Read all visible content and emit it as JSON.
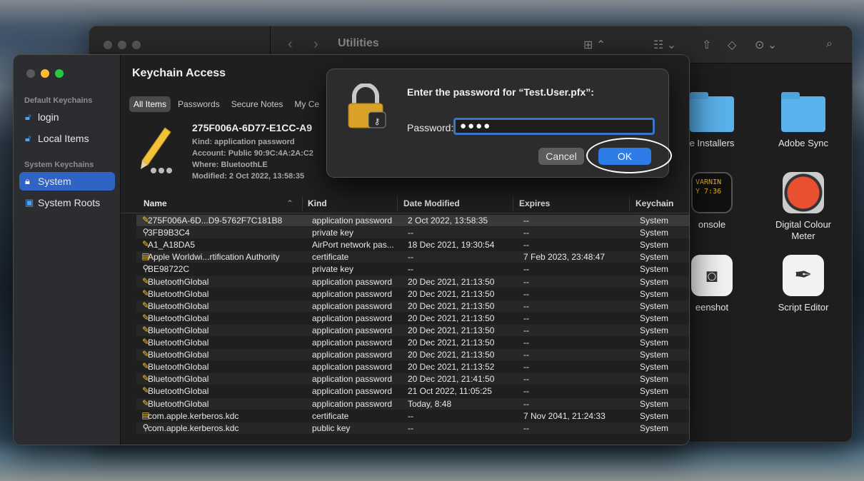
{
  "finder": {
    "title": "Utilities",
    "apps": [
      {
        "label": "e Installers",
        "icon": "folder-icon"
      },
      {
        "label": "Adobe Sync",
        "icon": "folder-icon"
      },
      {
        "label": "onsole",
        "icon": "console-icon",
        "icon_text": "VARNIN\nY 7:36"
      },
      {
        "label": "Digital Colour\nMeter",
        "icon": "colour-meter-icon"
      },
      {
        "label": "eenshot",
        "icon": "screenshot-icon"
      },
      {
        "label": "Script Editor",
        "icon": "script-editor-icon"
      }
    ]
  },
  "keychain": {
    "title": "Keychain Access",
    "sidebar": {
      "default_header": "Default Keychains",
      "system_header": "System Keychains",
      "items": [
        {
          "label": "login",
          "icon": "lock-open-icon"
        },
        {
          "label": "Local Items",
          "icon": "lock-open-icon"
        },
        {
          "label": "System",
          "icon": "lock-icon"
        },
        {
          "label": "System Roots",
          "icon": "cabinet-icon"
        }
      ]
    },
    "tabs": [
      "All Items",
      "Passwords",
      "Secure Notes",
      "My Ce"
    ],
    "detail": {
      "name": "275F006A-6D77-E1CC-A9",
      "kind": "Kind: application password",
      "account": "Account: Public 90:9C:4A:2A:C2",
      "where": "Where: BluetoothLE",
      "modified": "Modified: 2 Oct 2022, 13:58:35"
    },
    "columns": [
      "Name",
      "Kind",
      "Date Modified",
      "Expires",
      "Keychain"
    ],
    "rows": [
      {
        "icon": "pencil-icon",
        "name": "275F006A-6D...D9-5762F7C181B8",
        "kind": "application password",
        "date": "2 Oct 2022, 13:58:35",
        "expires": "--",
        "keychain": "System"
      },
      {
        "icon": "key-icon",
        "name": "3FB9B3C4",
        "kind": "private key",
        "date": "--",
        "expires": "--",
        "keychain": "System"
      },
      {
        "icon": "pencil-icon",
        "name": "A1_A18DA5",
        "kind": "AirPort network pas...",
        "date": "18 Dec 2021, 19:30:54",
        "expires": "--",
        "keychain": "System"
      },
      {
        "icon": "certificate-icon",
        "name": "Apple Worldwi...rtification Authority",
        "kind": "certificate",
        "date": "--",
        "expires": "7 Feb 2023, 23:48:47",
        "keychain": "System"
      },
      {
        "icon": "key-icon",
        "name": "BE98722C",
        "kind": "private key",
        "date": "--",
        "expires": "--",
        "keychain": "System"
      },
      {
        "icon": "pencil-icon",
        "name": "BluetoothGlobal",
        "kind": "application password",
        "date": "20 Dec 2021, 21:13:50",
        "expires": "--",
        "keychain": "System"
      },
      {
        "icon": "pencil-icon",
        "name": "BluetoothGlobal",
        "kind": "application password",
        "date": "20 Dec 2021, 21:13:50",
        "expires": "--",
        "keychain": "System"
      },
      {
        "icon": "pencil-icon",
        "name": "BluetoothGlobal",
        "kind": "application password",
        "date": "20 Dec 2021, 21:13:50",
        "expires": "--",
        "keychain": "System"
      },
      {
        "icon": "pencil-icon",
        "name": "BluetoothGlobal",
        "kind": "application password",
        "date": "20 Dec 2021, 21:13:50",
        "expires": "--",
        "keychain": "System"
      },
      {
        "icon": "pencil-icon",
        "name": "BluetoothGlobal",
        "kind": "application password",
        "date": "20 Dec 2021, 21:13:50",
        "expires": "--",
        "keychain": "System"
      },
      {
        "icon": "pencil-icon",
        "name": "BluetoothGlobal",
        "kind": "application password",
        "date": "20 Dec 2021, 21:13:50",
        "expires": "--",
        "keychain": "System"
      },
      {
        "icon": "pencil-icon",
        "name": "BluetoothGlobal",
        "kind": "application password",
        "date": "20 Dec 2021, 21:13:50",
        "expires": "--",
        "keychain": "System"
      },
      {
        "icon": "pencil-icon",
        "name": "BluetoothGlobal",
        "kind": "application password",
        "date": "20 Dec 2021, 21:13:52",
        "expires": "--",
        "keychain": "System"
      },
      {
        "icon": "pencil-icon",
        "name": "BluetoothGlobal",
        "kind": "application password",
        "date": "20 Dec 2021, 21:41:50",
        "expires": "--",
        "keychain": "System"
      },
      {
        "icon": "pencil-icon",
        "name": "BluetoothGlobal",
        "kind": "application password",
        "date": "21 Oct 2022, 11:05:25",
        "expires": "--",
        "keychain": "System"
      },
      {
        "icon": "pencil-icon",
        "name": "BluetoothGlobal",
        "kind": "application password",
        "date": "Today, 8:48",
        "expires": "--",
        "keychain": "System"
      },
      {
        "icon": "certificate-icon",
        "name": "com.apple.kerberos.kdc",
        "kind": "certificate",
        "date": "--",
        "expires": "7 Nov 2041, 21:24:33",
        "keychain": "System"
      },
      {
        "icon": "key-icon",
        "name": "com.apple.kerberos.kdc",
        "kind": "public key",
        "date": "--",
        "expires": "--",
        "keychain": "System"
      }
    ]
  },
  "dialog": {
    "title": "Enter the password for “Test.User.pfx”:",
    "password_label": "Password:",
    "password_value": "●●●●",
    "cancel_label": "Cancel",
    "ok_label": "OK"
  },
  "colors": {
    "accent": "#2e7ce6",
    "sidebar_selected": "#2f63c4",
    "traffic_red": "#ff5f57",
    "traffic_yellow": "#febc2e",
    "traffic_green": "#28c840"
  }
}
